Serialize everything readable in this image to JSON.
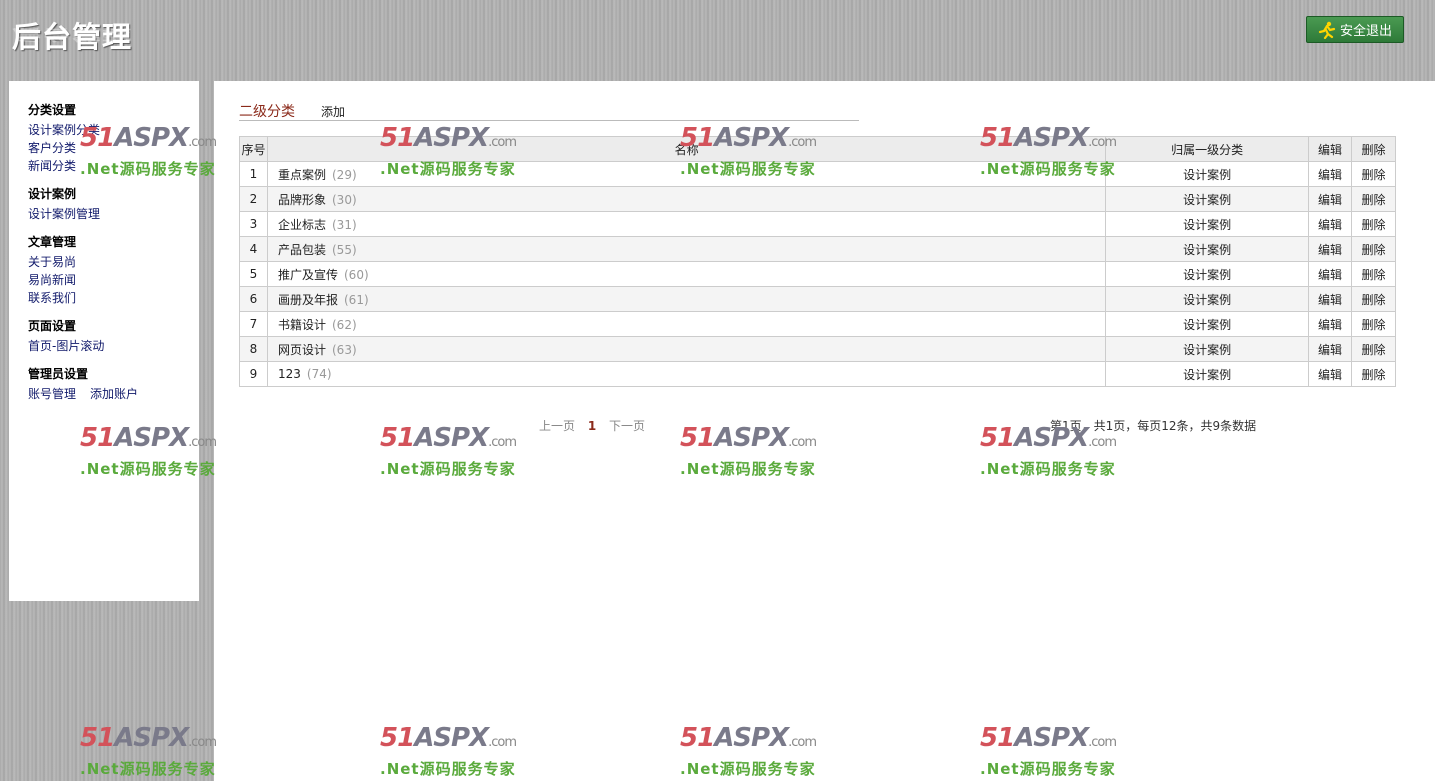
{
  "header": {
    "title": "后台管理",
    "logout_label": "安全退出"
  },
  "sidebar": {
    "groups": [
      {
        "title": "分类设置",
        "items": [
          "设计案例分类",
          "客户分类",
          "新闻分类"
        ]
      },
      {
        "title": "设计案例",
        "items": [
          "设计案例管理"
        ]
      },
      {
        "title": "文章管理",
        "items": [
          "关于易尚",
          "易尚新闻",
          "联系我们"
        ]
      },
      {
        "title": "页面设置",
        "items": [
          "首页-图片滚动"
        ]
      },
      {
        "title": "管理员设置",
        "items": [
          "账号管理",
          "添加账户"
        ]
      }
    ]
  },
  "tabs": {
    "current": "二级分类",
    "add": "添加"
  },
  "table": {
    "headers": [
      "序号",
      "名称",
      "归属一级分类",
      "编辑",
      "删除"
    ],
    "rows": [
      {
        "no": "1",
        "name": "重点案例",
        "count": "(29)",
        "parent": "设计案例",
        "edit": "编辑",
        "del": "删除"
      },
      {
        "no": "2",
        "name": "品牌形象",
        "count": "(30)",
        "parent": "设计案例",
        "edit": "编辑",
        "del": "删除"
      },
      {
        "no": "3",
        "name": "企业标志",
        "count": "(31)",
        "parent": "设计案例",
        "edit": "编辑",
        "del": "删除"
      },
      {
        "no": "4",
        "name": "产品包装",
        "count": "(55)",
        "parent": "设计案例",
        "edit": "编辑",
        "del": "删除"
      },
      {
        "no": "5",
        "name": "推广及宣传",
        "count": "(60)",
        "parent": "设计案例",
        "edit": "编辑",
        "del": "删除"
      },
      {
        "no": "6",
        "name": "画册及年报",
        "count": "(61)",
        "parent": "设计案例",
        "edit": "编辑",
        "del": "删除"
      },
      {
        "no": "7",
        "name": "书籍设计",
        "count": "(62)",
        "parent": "设计案例",
        "edit": "编辑",
        "del": "删除"
      },
      {
        "no": "8",
        "name": "网页设计",
        "count": "(63)",
        "parent": "设计案例",
        "edit": "编辑",
        "del": "删除"
      },
      {
        "no": "9",
        "name": "123",
        "count": "(74)",
        "parent": "设计案例",
        "edit": "编辑",
        "del": "删除"
      }
    ]
  },
  "pager": {
    "prev": "上一页",
    "current": "1",
    "next": "下一页",
    "info": "第1页，共1页，每页12条，共9条数据"
  },
  "watermark": {
    "logo_num": "51",
    "logo_word": "ASPX",
    "logo_dom": ".com",
    "slogan": ".Net源码服务专家"
  },
  "colors": {
    "tab_active": "#8b2a1a",
    "logout_bg": "#3a8a44",
    "watermark_red": "#d3525a",
    "watermark_green": "#5aaa3c"
  }
}
